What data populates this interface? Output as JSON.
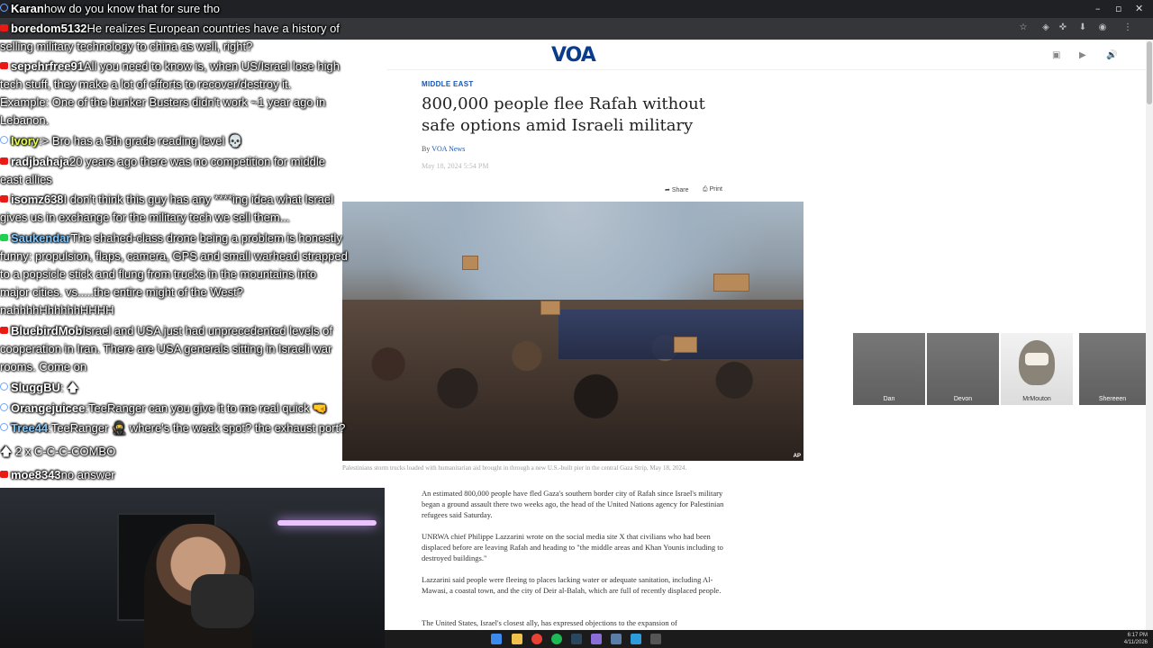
{
  "browser": {
    "window_controls": [
      "–",
      "▫",
      "✕"
    ],
    "toolbar_icons": [
      "star-icon",
      "extensions-icon",
      "puzzle-icon",
      "download-icon",
      "profile-icon",
      "menu-icon"
    ]
  },
  "voa": {
    "logo": "VOA",
    "section": "MIDDLE EAST",
    "headline": "800,000 people flee Rafah without safe options amid Israeli military",
    "byline_prefix": "By",
    "byline_author": "VOA News",
    "date": "May 18, 2024 5:54 PM",
    "share_label": "Share",
    "print_label": "Print",
    "photo_credit": "AP",
    "caption": "Palestinians storm trucks loaded with humanitarian aid brought in through a new U.S.-built pier in the central Gaza Strip, May 18, 2024.",
    "paragraphs": [
      "An estimated 800,000 people have fled Gaza's southern border city of Rafah since Israel's military began a ground assault there two weeks ago, the head of the United Nations agency for Palestinian refugees said Saturday.",
      "UNRWA chief Philippe Lazzarini wrote on the social media site X that civilians who had been displaced before are leaving Rafah and heading to \"the middle areas and Khan Younis including to destroyed buildings.\"",
      "Lazzarini said people were fleeing to places lacking water or adequate sanitation, including Al-Mawasi, a coastal town, and the city of Deir al-Balah, which are full of recently displaced people.",
      "The United States, Israel's closest ally, has expressed objections to the expansion of"
    ]
  },
  "participants": [
    "Dan",
    "Devon",
    "MrMouton",
    "Shereeen"
  ],
  "chat": [
    {
      "badge": "ring",
      "user": "Karan",
      "user_color": "#ffffff",
      "text": "how do you know that for sure tho"
    },
    {
      "badge": "red",
      "user": "boredom5132",
      "user_color": "#ffffff",
      "text": "He realizes European countries have a history of"
    },
    {
      "badge": "",
      "user": "",
      "user_color": "#ffffff",
      "text": "selling military technology to china as well, right?"
    },
    {
      "badge": "red",
      "user": "sepehrfree91",
      "user_color": "#ffffff",
      "text": "All you need to know is, when US/Israel lose high"
    },
    {
      "badge": "",
      "user": "",
      "user_color": "#ffffff",
      "text": "tech stuff, they make a lot of efforts to recover/destroy it."
    },
    {
      "badge": "",
      "user": "",
      "user_color": "#ffffff",
      "text": "Example: One of the bunker Busters didn't work ~1 year ago in"
    },
    {
      "badge": "",
      "user": "",
      "user_color": "#ffffff",
      "text": "Lebanon."
    },
    {
      "badge": "ring",
      "user": "Ivory",
      "user_color": "#e8ff58",
      "text": ":> Bro has a 5th grade reading level 💀"
    },
    {
      "badge": "red",
      "user": "radjbahaja",
      "user_color": "#ffffff",
      "text": "20 years ago there was no competition for middle"
    },
    {
      "badge": "",
      "user": "",
      "user_color": "#ffffff",
      "text": "east allies"
    },
    {
      "badge": "red",
      "user": "isomz638",
      "user_color": "#ffffff",
      "text": "I don't think this guy has any ****ing idea what Israel"
    },
    {
      "badge": "",
      "user": "",
      "user_color": "#ffffff",
      "text": "gives us in exchange for the military tech we sell them..."
    },
    {
      "badge": "green",
      "user": "Saukendar",
      "user_color": "#7ec8ff",
      "text": "The shahed-class drone being a problem is honestly"
    },
    {
      "badge": "",
      "user": "",
      "user_color": "#ffffff",
      "text": "funny: propulsion, flaps, camera, GPS and small warhead strapped"
    },
    {
      "badge": "",
      "user": "",
      "user_color": "#ffffff",
      "text": "to a popsicle stick and flung from trucks in the mountains into"
    },
    {
      "badge": "",
      "user": "",
      "user_color": "#ffffff",
      "text": "major cities. vs.....the entire might of the West?"
    },
    {
      "badge": "",
      "user": "",
      "user_color": "#ffffff",
      "text": "nahhhhHhhhhhHHHH"
    },
    {
      "badge": "red",
      "user": "BluebirdMob",
      "user_color": "#ffffff",
      "text": "Israel and USA just had unprecedented levels of"
    },
    {
      "badge": "",
      "user": "",
      "user_color": "#ffffff",
      "text": "cooperation in Iran. There are USA generals sitting in Israeli war"
    },
    {
      "badge": "",
      "user": "",
      "user_color": "#ffffff",
      "text": "rooms. Come on"
    },
    {
      "badge": "ring",
      "user": "SluggBU",
      "user_color": "#ffffff",
      "text": ": 🡅"
    },
    {
      "badge": "ring",
      "user": "Orangejuicee",
      "user_color": "#ffffff",
      "text": ":TeeRanger can you give it to me real quick 🤜"
    },
    {
      "badge": "ring",
      "user": "Tree44",
      "user_color": "#7ec8ff",
      "text": ":TeeRanger 🥷 where's the weak spot? the exhaust port?"
    },
    {
      "badge": "",
      "user": "",
      "user_color": "#ffffff",
      "text": "🡅 2 x C-C-C-COMBO"
    },
    {
      "badge": "red",
      "user": "moe8343",
      "user_color": "#ffffff",
      "text": "no answer"
    }
  ],
  "taskbar": {
    "time": "6:17 PM",
    "date": "4/11/2026"
  }
}
